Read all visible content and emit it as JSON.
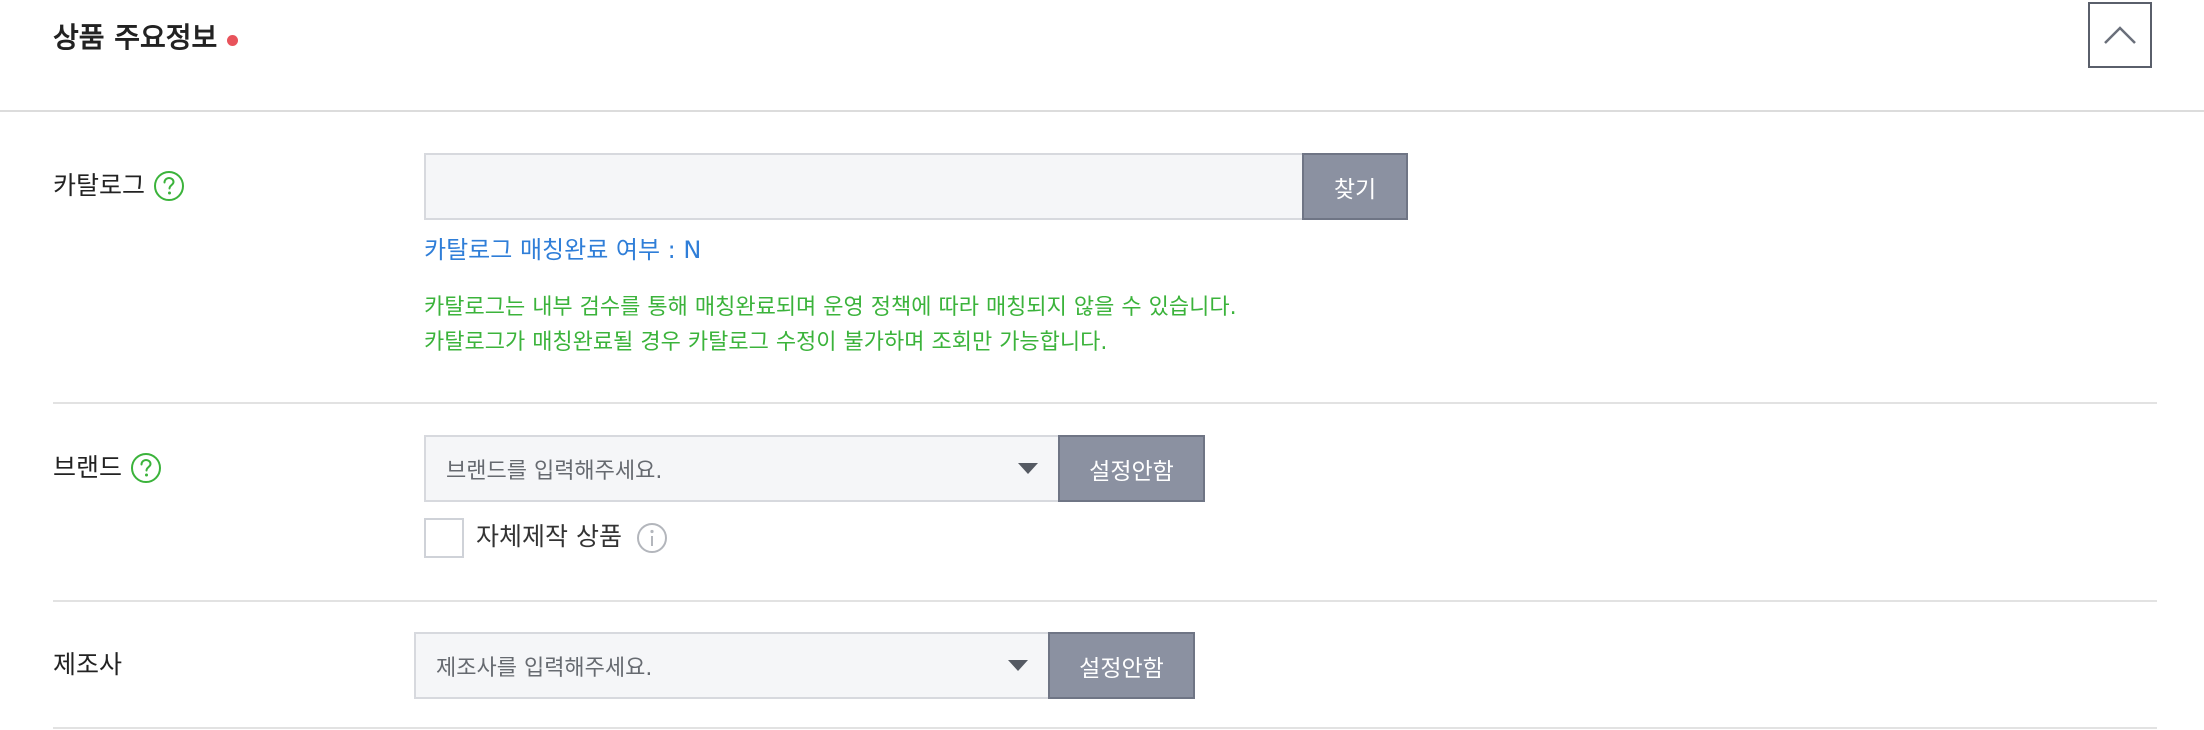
{
  "section": {
    "title": "상품 주요정보",
    "required_color": "#e8535b",
    "collapse_icon": "chevron-up-icon"
  },
  "catalog": {
    "label": "카탈로그",
    "help_icon": "question-circle-icon",
    "input_value": "",
    "search_button": "찾기",
    "match_status": "카탈로그 매칭완료 여부 : N",
    "notice_lines": [
      "카탈로그는 내부 검수를 통해 매칭완료되며 운영 정책에 따라 매칭되지 않을 수 있습니다.",
      "카탈로그가 매칭완료될 경우 카탈로그 수정이 불가하며 조회만 가능합니다."
    ]
  },
  "brand": {
    "label": "브랜드",
    "help_icon": "question-circle-icon",
    "placeholder": "브랜드를 입력해주세요.",
    "no_setting_button": "설정안함",
    "self_made_label": "자체제작 상품",
    "self_made_checked": false,
    "info_icon": "info-circle-icon"
  },
  "manufacturer": {
    "label": "제조사",
    "placeholder": "제조사를 입력해주세요.",
    "no_setting_button": "설정안함"
  },
  "colors": {
    "link_blue": "#2f7ed8",
    "notice_green": "#3bb33b",
    "help_green": "#3bb33b",
    "button_gray": "#8b91a1"
  }
}
